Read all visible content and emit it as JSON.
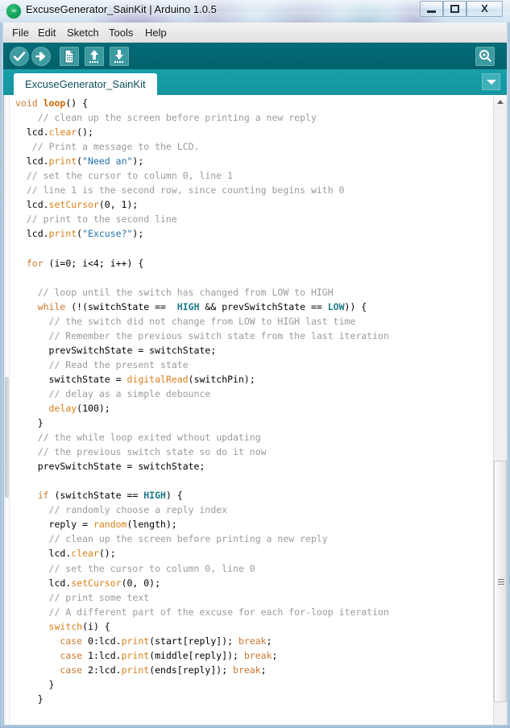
{
  "window": {
    "title": "ExcuseGenerator_SainKit | Arduino 1.0.5",
    "app_icon_name": "arduino-infinity-logo",
    "minimize_label": "",
    "maximize_label": "",
    "close_label": "X"
  },
  "menubar": {
    "items": [
      {
        "label": "File"
      },
      {
        "label": "Edit"
      },
      {
        "label": "Sketch"
      },
      {
        "label": "Tools"
      },
      {
        "label": "Help"
      }
    ]
  },
  "toolbar": {
    "buttons": [
      {
        "name": "verify-button",
        "icon": "checkmark-icon",
        "tooltip": "Verify"
      },
      {
        "name": "upload-button",
        "icon": "right-arrow-icon",
        "tooltip": "Upload"
      },
      {
        "name": "new-button",
        "icon": "new-document-icon",
        "tooltip": "New"
      },
      {
        "name": "open-button",
        "icon": "up-arrow-icon",
        "tooltip": "Open"
      },
      {
        "name": "save-button",
        "icon": "down-arrow-icon",
        "tooltip": "Save"
      }
    ],
    "serial_monitor": {
      "name": "serial-monitor-button",
      "icon": "magnifier-icon",
      "tooltip": "Serial Monitor"
    }
  },
  "tabs": {
    "active": "ExcuseGenerator_SainKit",
    "dropdown_icon": "chevron-down-icon"
  },
  "colors": {
    "toolbar_bg": "#026670",
    "tabstrip_bg": "#1a9ba5",
    "tab_active_bg": "#ffffff",
    "button_bg": "#3d9aa1",
    "comment": "#9b9b9b",
    "keyword": "#cc7832",
    "function": "#d9801a",
    "string": "#1f6fa8",
    "constant": "#1c7a86",
    "editor_bg": "#ffffff",
    "text": "#000000"
  },
  "editor": {
    "language": "arduino-c",
    "lines": [
      [
        {
          "t": "void ",
          "c": "kw"
        },
        {
          "t": "loop",
          "c": "kwb"
        },
        {
          "t": "() {",
          "c": "pl"
        }
      ],
      [
        {
          "t": "    // clean up the screen before printing a new reply",
          "c": "cm"
        }
      ],
      [
        {
          "t": "  lcd.",
          "c": "pl"
        },
        {
          "t": "clear",
          "c": "fn"
        },
        {
          "t": "();",
          "c": "pl"
        }
      ],
      [
        {
          "t": "   // Print a message to the LCD.",
          "c": "cm"
        }
      ],
      [
        {
          "t": "  lcd.",
          "c": "pl"
        },
        {
          "t": "print",
          "c": "fn"
        },
        {
          "t": "(",
          "c": "pl"
        },
        {
          "t": "\"Need an\"",
          "c": "st"
        },
        {
          "t": ");",
          "c": "pl"
        }
      ],
      [
        {
          "t": "  // set the cursor to column 0, line 1",
          "c": "cm"
        }
      ],
      [
        {
          "t": "  // line 1 is the second row, since counting begins with 0",
          "c": "cm"
        }
      ],
      [
        {
          "t": "  lcd.",
          "c": "pl"
        },
        {
          "t": "setCursor",
          "c": "fn"
        },
        {
          "t": "(0, 1);",
          "c": "pl"
        }
      ],
      [
        {
          "t": "  // print to the second line",
          "c": "cm"
        }
      ],
      [
        {
          "t": "  lcd.",
          "c": "pl"
        },
        {
          "t": "print",
          "c": "fn"
        },
        {
          "t": "(",
          "c": "pl"
        },
        {
          "t": "\"Excuse?\"",
          "c": "st"
        },
        {
          "t": ");",
          "c": "pl"
        }
      ],
      [
        {
          "t": "",
          "c": "pl"
        }
      ],
      [
        {
          "t": "  for",
          "c": "kw"
        },
        {
          "t": " (i=0; i<4; i++) {",
          "c": "pl"
        }
      ],
      [
        {
          "t": "",
          "c": "pl"
        }
      ],
      [
        {
          "t": "    // loop until the switch has changed from LOW to HIGH",
          "c": "cm"
        }
      ],
      [
        {
          "t": "    while",
          "c": "kw"
        },
        {
          "t": " (!(switchState ==  ",
          "c": "pl"
        },
        {
          "t": "HIGH",
          "c": "cst"
        },
        {
          "t": " && prevSwitchState == ",
          "c": "pl"
        },
        {
          "t": "LOW",
          "c": "cst"
        },
        {
          "t": ")) {",
          "c": "pl"
        }
      ],
      [
        {
          "t": "      // the switch did not change from LOW to HIGH last time",
          "c": "cm"
        }
      ],
      [
        {
          "t": "      // Remember the previous switch state from the last iteration",
          "c": "cm"
        }
      ],
      [
        {
          "t": "      prevSwitchState = switchState;",
          "c": "pl"
        }
      ],
      [
        {
          "t": "      // Read the present state",
          "c": "cm"
        }
      ],
      [
        {
          "t": "      switchState = ",
          "c": "pl"
        },
        {
          "t": "digitalRead",
          "c": "fn"
        },
        {
          "t": "(switchPin);",
          "c": "pl"
        }
      ],
      [
        {
          "t": "      // delay as a simple debounce",
          "c": "cm"
        }
      ],
      [
        {
          "t": "      ",
          "c": "pl"
        },
        {
          "t": "delay",
          "c": "fn"
        },
        {
          "t": "(100);",
          "c": "pl"
        }
      ],
      [
        {
          "t": "    }",
          "c": "pl"
        }
      ],
      [
        {
          "t": "    // the while loop exited wthout updating",
          "c": "cm"
        }
      ],
      [
        {
          "t": "    // the previous switch state so do it now",
          "c": "cm"
        }
      ],
      [
        {
          "t": "    prevSwitchState = switchState;",
          "c": "pl"
        }
      ],
      [
        {
          "t": "",
          "c": "pl"
        }
      ],
      [
        {
          "t": "    if",
          "c": "kw"
        },
        {
          "t": " (switchState == ",
          "c": "pl"
        },
        {
          "t": "HIGH",
          "c": "cst"
        },
        {
          "t": ") {",
          "c": "pl"
        }
      ],
      [
        {
          "t": "      // randomly choose a reply index",
          "c": "cm"
        }
      ],
      [
        {
          "t": "      reply = ",
          "c": "pl"
        },
        {
          "t": "random",
          "c": "fn"
        },
        {
          "t": "(length);",
          "c": "pl"
        }
      ],
      [
        {
          "t": "      // clean up the screen before printing a new reply",
          "c": "cm"
        }
      ],
      [
        {
          "t": "      lcd.",
          "c": "pl"
        },
        {
          "t": "clear",
          "c": "fn"
        },
        {
          "t": "();",
          "c": "pl"
        }
      ],
      [
        {
          "t": "      // set the cursor to column 0, line 0",
          "c": "cm"
        }
      ],
      [
        {
          "t": "      lcd.",
          "c": "pl"
        },
        {
          "t": "setCursor",
          "c": "fn"
        },
        {
          "t": "(0, 0);",
          "c": "pl"
        }
      ],
      [
        {
          "t": "      // print some text",
          "c": "cm"
        }
      ],
      [
        {
          "t": "      // A different part of the excuse for each for-loop iteration",
          "c": "cm"
        }
      ],
      [
        {
          "t": "      ",
          "c": "pl"
        },
        {
          "t": "switch",
          "c": "fn"
        },
        {
          "t": "(i) {",
          "c": "pl"
        }
      ],
      [
        {
          "t": "        ",
          "c": "pl"
        },
        {
          "t": "case",
          "c": "kw"
        },
        {
          "t": " 0:lcd.",
          "c": "pl"
        },
        {
          "t": "print",
          "c": "fn"
        },
        {
          "t": "(start[reply]); ",
          "c": "pl"
        },
        {
          "t": "break",
          "c": "kw"
        },
        {
          "t": ";",
          "c": "pl"
        }
      ],
      [
        {
          "t": "        ",
          "c": "pl"
        },
        {
          "t": "case",
          "c": "kw"
        },
        {
          "t": " 1:lcd.",
          "c": "pl"
        },
        {
          "t": "print",
          "c": "fn"
        },
        {
          "t": "(middle[reply]); ",
          "c": "pl"
        },
        {
          "t": "break",
          "c": "kw"
        },
        {
          "t": ";",
          "c": "pl"
        }
      ],
      [
        {
          "t": "        ",
          "c": "pl"
        },
        {
          "t": "case",
          "c": "kw"
        },
        {
          "t": " 2:lcd.",
          "c": "pl"
        },
        {
          "t": "print",
          "c": "fn"
        },
        {
          "t": "(ends[reply]); ",
          "c": "pl"
        },
        {
          "t": "break",
          "c": "kw"
        },
        {
          "t": ";",
          "c": "pl"
        }
      ],
      [
        {
          "t": "      }",
          "c": "pl"
        }
      ],
      [
        {
          "t": "    }",
          "c": "pl"
        }
      ]
    ]
  },
  "scrollbar": {
    "up_arrow_icon": "triangle-up-icon",
    "thumb_grip_icon": "grip-lines-icon"
  }
}
